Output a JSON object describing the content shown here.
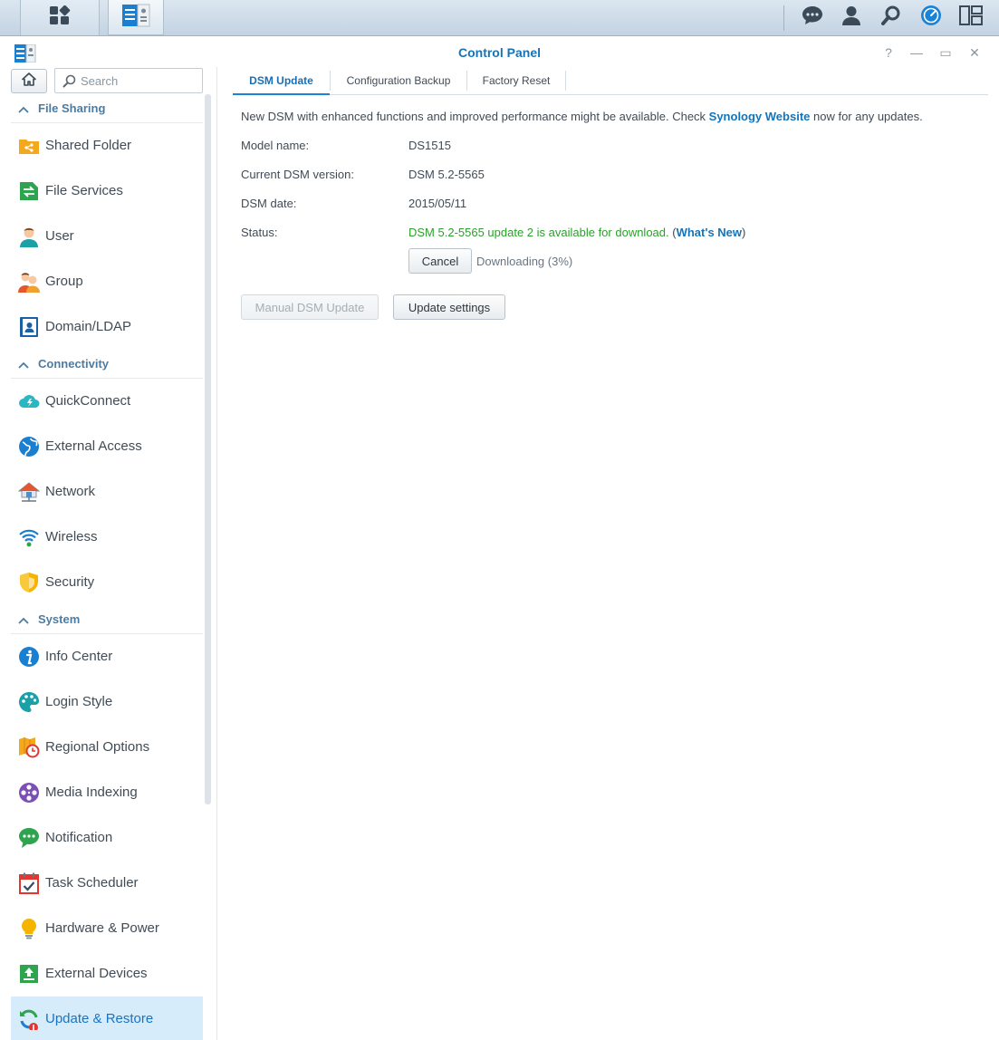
{
  "taskbar": {
    "main_menu_icon": "grid-icon",
    "open_app_icon": "control-panel-icon",
    "right_icons": [
      "chat-icon",
      "user-icon",
      "search-icon",
      "dashboard-icon",
      "widgets-icon"
    ]
  },
  "window": {
    "title": "Control Panel",
    "help": "?",
    "minimize": "—",
    "restore": "▭",
    "close": "✕"
  },
  "sidebar": {
    "search_placeholder": "Search",
    "sections": [
      {
        "label": "File Sharing",
        "items": [
          {
            "label": "Shared Folder",
            "icon": "shared-folder-icon"
          },
          {
            "label": "File Services",
            "icon": "file-services-icon"
          },
          {
            "label": "User",
            "icon": "user-icon"
          },
          {
            "label": "Group",
            "icon": "group-icon"
          },
          {
            "label": "Domain/LDAP",
            "icon": "domain-ldap-icon"
          }
        ]
      },
      {
        "label": "Connectivity",
        "items": [
          {
            "label": "QuickConnect",
            "icon": "quickconnect-icon"
          },
          {
            "label": "External Access",
            "icon": "globe-icon"
          },
          {
            "label": "Network",
            "icon": "network-house-icon"
          },
          {
            "label": "Wireless",
            "icon": "wifi-icon"
          },
          {
            "label": "Security",
            "icon": "shield-icon"
          }
        ]
      },
      {
        "label": "System",
        "items": [
          {
            "label": "Info Center",
            "icon": "info-icon"
          },
          {
            "label": "Login Style",
            "icon": "palette-icon"
          },
          {
            "label": "Regional Options",
            "icon": "map-clock-icon"
          },
          {
            "label": "Media Indexing",
            "icon": "film-reel-icon"
          },
          {
            "label": "Notification",
            "icon": "speech-bubble-icon"
          },
          {
            "label": "Task Scheduler",
            "icon": "calendar-check-icon"
          },
          {
            "label": "Hardware & Power",
            "icon": "lightbulb-icon"
          },
          {
            "label": "External Devices",
            "icon": "upload-box-icon"
          },
          {
            "label": "Update & Restore",
            "icon": "update-restore-icon"
          }
        ]
      }
    ]
  },
  "tabs": [
    "DSM Update",
    "Configuration Backup",
    "Factory Reset"
  ],
  "main": {
    "intro_before": "New DSM with enhanced functions and improved performance might be available. Check ",
    "intro_link": "Synology Website",
    "intro_after": " now for any updates.",
    "model_label": "Model name:",
    "model_value": "DS1515",
    "version_label": "Current DSM version:",
    "version_value": "DSM 5.2-5565",
    "date_label": "DSM date:",
    "date_value": "2015/05/11",
    "status_label": "Status:",
    "status_value": "DSM 5.2-5565 update 2 is available for download.",
    "status_paren_open": " (",
    "whats_new": "What's New",
    "status_paren_close": ")",
    "cancel_label": "Cancel",
    "downloading": "Downloading (3%)",
    "manual_update_label": "Manual DSM Update",
    "update_settings_label": "Update settings"
  },
  "colors": {
    "accent": "#1574b8",
    "status_green": "#2ba02b",
    "selected_bg": "#d6ecfb"
  }
}
